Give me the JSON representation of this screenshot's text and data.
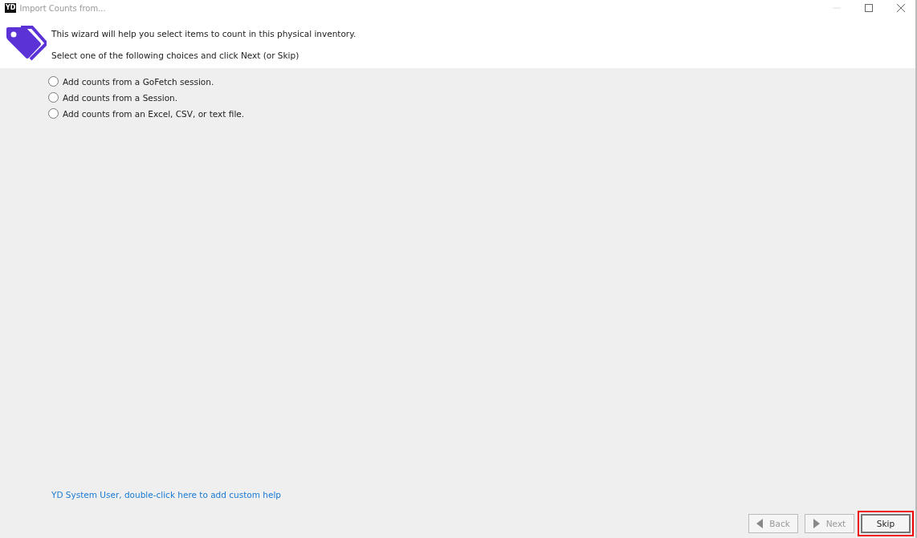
{
  "window": {
    "logo": "YD",
    "title": "Import Counts from..."
  },
  "header": {
    "intro": "This wizard will help you select items to count in this physical inventory.",
    "instruction": "Select one of the following choices and click Next (or Skip)"
  },
  "choices": [
    {
      "label": "Add counts from a GoFetch session.",
      "selected": false
    },
    {
      "label": "Add counts from a Session.",
      "selected": false
    },
    {
      "label": "Add counts from an Excel, CSV, or text file.",
      "selected": false
    }
  ],
  "help_link": "YD System User, double-click here to add custom help",
  "buttons": [
    {
      "label": "Back",
      "kind": "back",
      "disabled": true,
      "highlighted": false
    },
    {
      "label": "Next",
      "kind": "next",
      "disabled": true,
      "highlighted": false
    },
    {
      "label": "Skip",
      "kind": "plain",
      "disabled": false,
      "highlighted": true
    }
  ]
}
